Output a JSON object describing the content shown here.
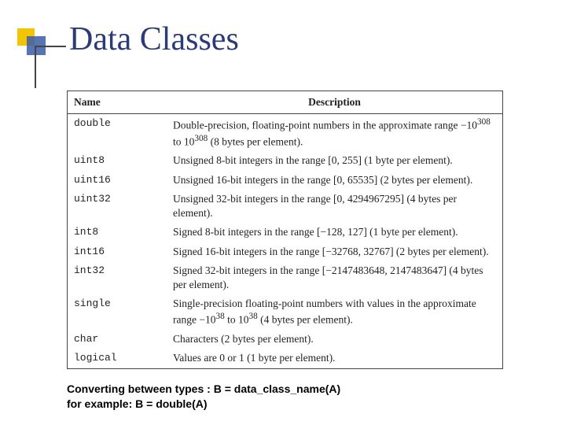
{
  "title": "Data Classes",
  "table": {
    "headers": {
      "name": "Name",
      "description": "Description"
    },
    "rows": [
      {
        "name": "double",
        "desc": "Double-precision, floating-point numbers in the approximate range −10^308 to 10^308 (8 bytes per element)."
      },
      {
        "name": "uint8",
        "desc": "Unsigned 8-bit integers in the range [0, 255] (1 byte per element)."
      },
      {
        "name": "uint16",
        "desc": "Unsigned 16-bit integers in the range [0, 65535] (2 bytes per element)."
      },
      {
        "name": "uint32",
        "desc": "Unsigned 32-bit integers in the range [0, 4294967295] (4 bytes per element)."
      },
      {
        "name": "int8",
        "desc": "Signed 8-bit integers in the range [−128, 127] (1 byte per element)."
      },
      {
        "name": "int16",
        "desc": "Signed 16-bit integers in the range [−32768, 32767] (2 bytes per element)."
      },
      {
        "name": "int32",
        "desc": "Signed 32-bit integers in the range [−2147483648, 2147483647] (4 bytes per element)."
      },
      {
        "name": "single",
        "desc": "Single-precision floating-point numbers with values in the approximate range −10^38 to 10^38 (4 bytes per element)."
      },
      {
        "name": "char",
        "desc": "Characters (2 bytes per element)."
      },
      {
        "name": "logical",
        "desc": "Values are 0 or 1 (1 byte per element)."
      }
    ]
  },
  "footer": {
    "line1": "Converting between types : B = data_class_name(A)",
    "line2": "for example: B = double(A)"
  }
}
